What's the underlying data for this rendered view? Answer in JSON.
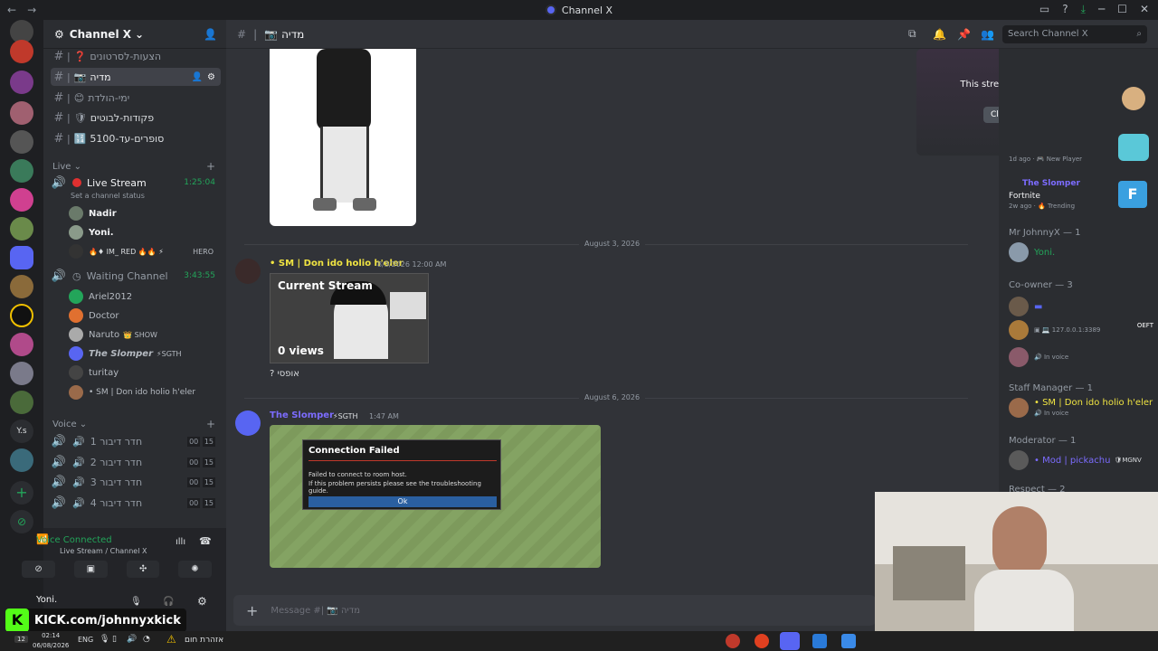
{
  "window": {
    "title": "Channel X",
    "minimize": "─",
    "maximize": "☐",
    "close": "✕"
  },
  "server": {
    "name": "Channel X"
  },
  "channels": [
    {
      "name": "הצעות-לסרטונים",
      "emoji": "❓"
    },
    {
      "name": "מדיה",
      "emoji": "📷"
    },
    {
      "name": "ימי-הולדת",
      "emoji": "😊"
    },
    {
      "name": "פקודות-לבוטים",
      "emoji": "🛡"
    },
    {
      "name": "סופרים-עד-5100",
      "emoji": "🔢"
    }
  ],
  "live": {
    "section": "Live",
    "stream_channel": "Live Stream",
    "stream_timer": "1:25:04",
    "status_hint": "Set a channel status",
    "stream_users": [
      "Nadir",
      "Yoni.",
      "HERO"
    ],
    "waiting_channel": "Waiting Channel",
    "waiting_timer": "3:43:55",
    "waiting_users": [
      "Ariel2012",
      "Doctor",
      "Naruto",
      "The Slomper",
      "turitay",
      "• SM | Don ido holio h'eler"
    ],
    "naruto_tag": "SHOW",
    "slomper_tag": "SGTH"
  },
  "voice": {
    "section": "Voice",
    "rooms": [
      {
        "name": "חדר דיבור 1",
        "a": "00",
        "b": "15"
      },
      {
        "name": "חדר דיבור 2",
        "a": "00",
        "b": "15"
      },
      {
        "name": "חדר דיבור 3",
        "a": "00",
        "b": "15"
      },
      {
        "name": "חדר דיבור 4",
        "a": "00",
        "b": "15"
      }
    ]
  },
  "voice_panel": {
    "status": "Voice Connected",
    "location": "Live Stream / Channel X",
    "user": "Yoni."
  },
  "main_header": {
    "channel": "מדיה",
    "search_placeholder": "Search Channel X"
  },
  "messages": {
    "date1": "August 3, 2026",
    "author1": "• SM | Don ido holio h'eler",
    "time1": "8/3/2026 12:00 AM",
    "embed_title": "Current Stream",
    "embed_views": "0 views",
    "text1": "? אופסי",
    "date2": "August 6, 2026",
    "author2": "The Slomper",
    "tag2": "SGTH",
    "time2": "1:47 AM",
    "dialog_title": "Connection Failed",
    "dialog_line1": "Failed to connect to room host.",
    "dialog_line2": "If this problem persists please see the troubleshooting guide.",
    "dialog_ok": "Ok",
    "composer_placeholder": "Message #| 📷 מדיה"
  },
  "stream_popup": {
    "text": "This stream has ended.",
    "close": "Close Stream"
  },
  "activity": [
    {
      "meta": "1d ago",
      "tag": "New Player"
    },
    {
      "name": "The Slomper",
      "game": "Fortnite",
      "meta": "2w ago",
      "tag": "Trending"
    }
  ],
  "members": {
    "owner_header": "Mr JohnnyX — 1",
    "owner": "Yoni.",
    "coowner_header": "Co-owner — 3",
    "co1_tag": "OEFT",
    "co1_ip": "127.0.0.1:3389",
    "co_status": "In voice",
    "staff_header": "Staff Manager — 1",
    "staff": "• SM | Don ido holio h'eler",
    "staff_status": "In voice",
    "mod_header": "Moderator — 1",
    "mod": "• Mod | pickachu",
    "mod_tag": "MGNV",
    "respect_header": "Respect — 2"
  },
  "overlay": {
    "kick": "KICK.com/johnnyxkick"
  },
  "taskbar": {
    "time": "02:14",
    "date": "06/08/2026",
    "lang": "ENG",
    "warning": "אזהרת חום",
    "badge": "12"
  },
  "colors": {
    "accent": "#5865f2",
    "green": "#23a55a",
    "kick": "#53fc18",
    "staff": "#f0e442",
    "slomper": "#7c6cff"
  }
}
